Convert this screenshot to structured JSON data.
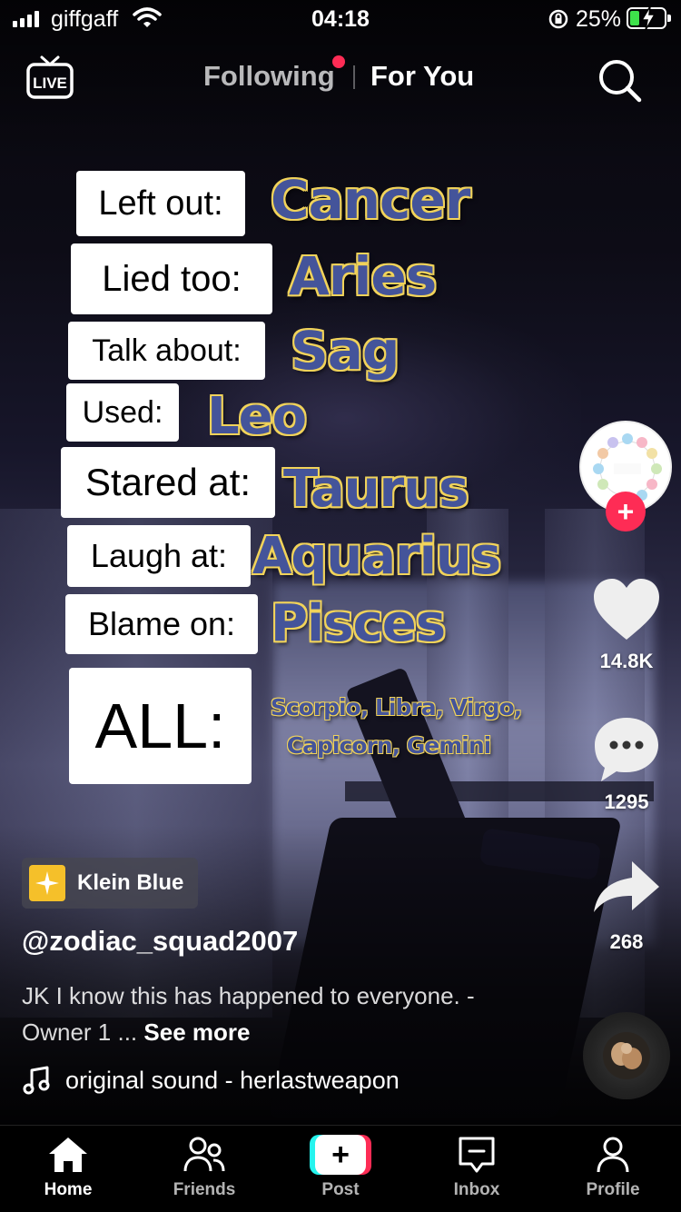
{
  "status_bar": {
    "carrier": "giffgaff",
    "time": "04:18",
    "battery": "25%",
    "battery_level": 0.25,
    "battery_fill_color": "#3ee24b"
  },
  "top_nav": {
    "live_label": "LIVE",
    "tab_following": "Following",
    "tab_for_you": "For You",
    "active_tab": "For You",
    "notification_dot_color": "#fe2c55",
    "search_icon": "search-icon"
  },
  "overlay": {
    "rows": [
      {
        "label": "Left out:",
        "sign": "Cancer"
      },
      {
        "label": "Lied too:",
        "sign": "Aries"
      },
      {
        "label": "Talk about:",
        "sign": "Sag"
      },
      {
        "label": "Used:",
        "sign": "Leo"
      },
      {
        "label": "Stared at:",
        "sign": "Taurus"
      },
      {
        "label": "Laugh at:",
        "sign": "Aquarius"
      },
      {
        "label": "Blame on:",
        "sign": "Pisces"
      }
    ],
    "all_label": "ALL:",
    "all_signs_line1": "Scorpio, Libra, Virgo,",
    "all_signs_line2": "Capicorn, Gemini",
    "sign_fill_color": "#44549a",
    "sign_outline_color": "#f1d35a"
  },
  "right_rail": {
    "likes": "14.8K",
    "comments": "1295",
    "shares": "268",
    "follow_icon": "plus-icon",
    "like_icon": "heart-icon",
    "comment_icon": "comment-icon",
    "share_icon": "share-arrow-icon",
    "accent": "#fe2c55"
  },
  "caption": {
    "sound_tag": "Klein Blue",
    "username": "@zodiac_squad2007",
    "text": "JK I know this has happened to everyone. - Owner 1 ...",
    "see_more": "See more",
    "sound": "original sound - herlastweapon"
  },
  "tab_bar": {
    "home": "Home",
    "friends": "Friends",
    "post": "Post",
    "inbox": "Inbox",
    "profile": "Profile",
    "active": "Home"
  }
}
